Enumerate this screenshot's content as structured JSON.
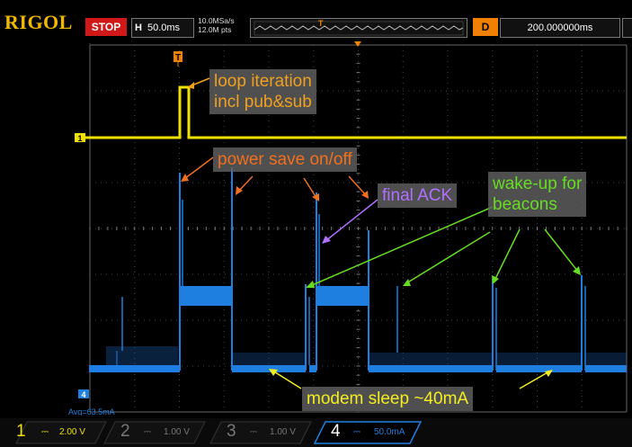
{
  "header": {
    "brand": "RIGOL",
    "run_state": "STOP",
    "timebase_letter": "H",
    "timebase_value": "50.0ms",
    "sample_rate": "10.0MSa/s",
    "memory_depth": "12.0M pts",
    "trigger_marker": "T",
    "delay_letter": "D",
    "delay_value": "200.000000ms"
  },
  "screen": {
    "trigger_marker": "T",
    "channel1_marker": "1",
    "channel4_marker": "4",
    "average_readout": "Avg=63.5mA"
  },
  "annotations": {
    "loop_iteration": [
      "loop iteration",
      "incl pub&sub"
    ],
    "power_save": "power save on/off",
    "final_ack": "final ACK",
    "wake_up": [
      "wake-up for",
      "beacons"
    ],
    "modem_sleep": "modem sleep ~40mA"
  },
  "channels": [
    {
      "number": "1",
      "scale": "2.00 V",
      "active": true,
      "color": "#f0e000"
    },
    {
      "number": "2",
      "scale": "1.00 V",
      "active": false,
      "color": "#777777"
    },
    {
      "number": "3",
      "scale": "1.00 V",
      "active": false,
      "color": "#777777"
    },
    {
      "number": "4",
      "scale": "50.0mA",
      "active": true,
      "color": "#2288ff"
    }
  ],
  "colors": {
    "brand": "#f0b800",
    "stop": "#d01818",
    "trigger": "#f08000",
    "ch1_trace": "#f0e000",
    "ch4_trace": "#1e7fe0",
    "note_orange": "#f08a3c",
    "note_purple": "#b070ff",
    "note_green": "#66dd22",
    "note_yellow": "#f2ee20"
  }
}
